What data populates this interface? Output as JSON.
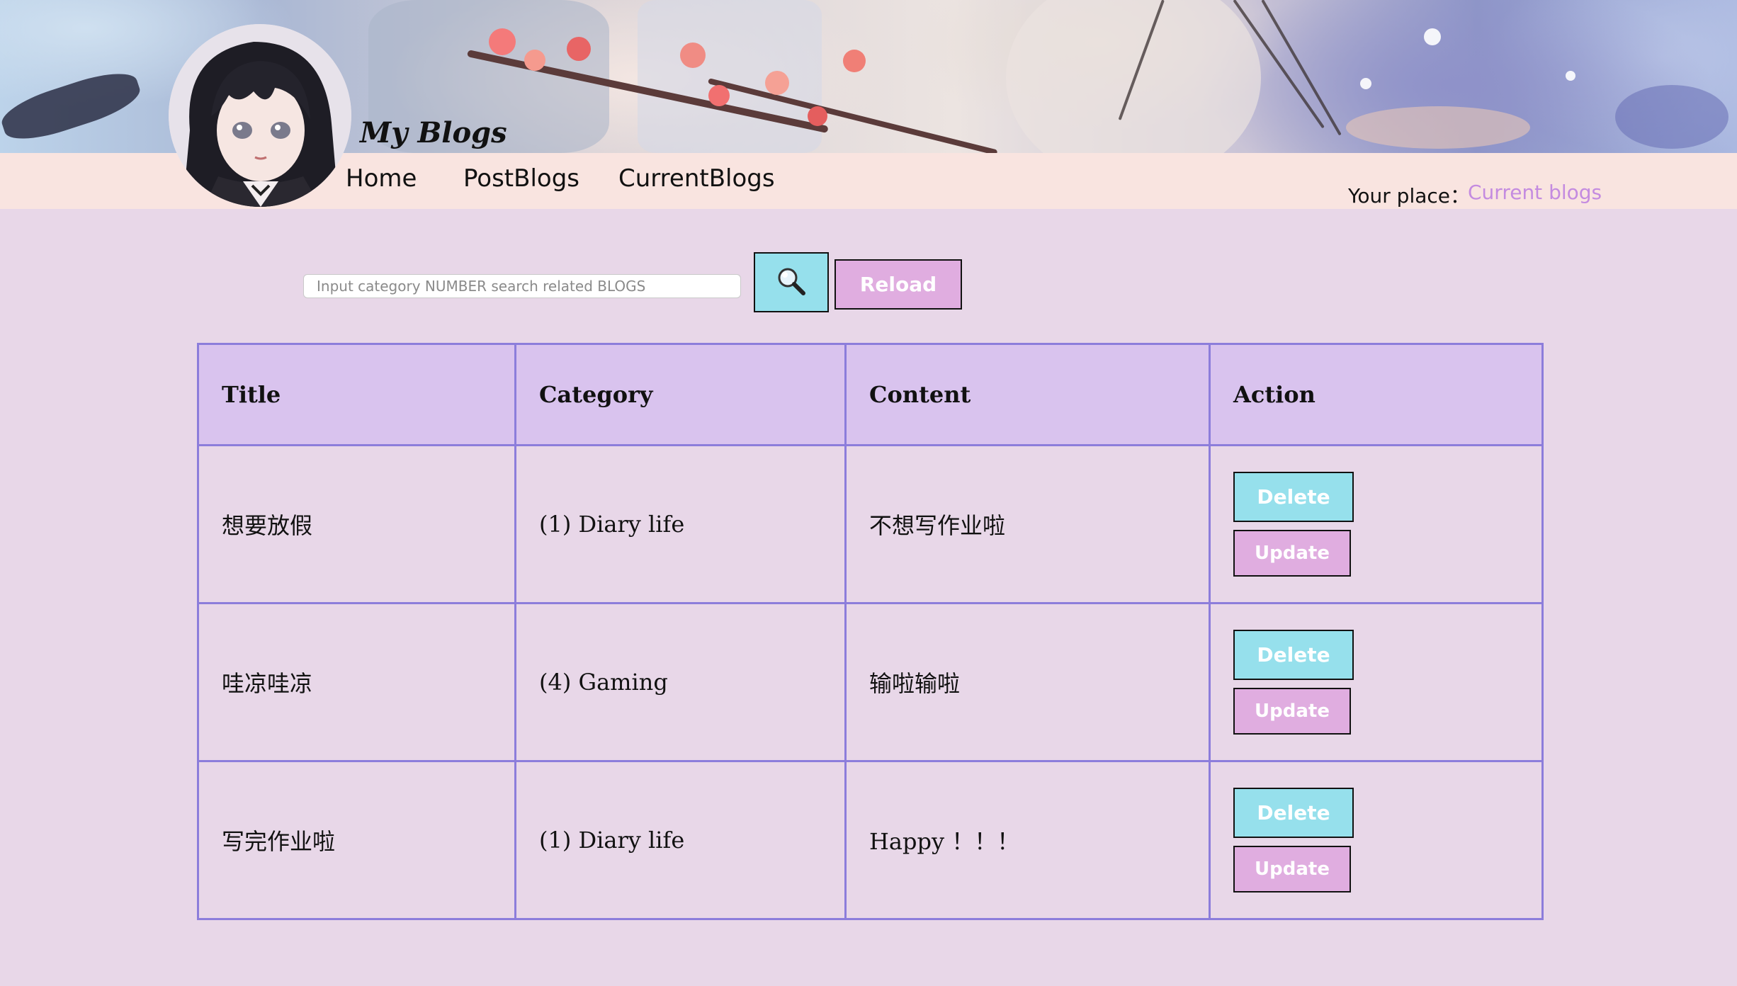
{
  "header": {
    "site_title": "My Blogs",
    "nav": [
      {
        "label": "Home"
      },
      {
        "label": "PostBlogs"
      },
      {
        "label": "CurrentBlogs"
      }
    ],
    "place_label": "Your place：",
    "place_value": "Current blogs"
  },
  "search": {
    "placeholder": "Input category NUMBER search related BLOGS",
    "value": "",
    "search_icon": "magnifier-icon",
    "reload_label": "Reload"
  },
  "table": {
    "headers": [
      "Title",
      "Category",
      "Content",
      "Action"
    ],
    "rows": [
      {
        "title": "想要放假",
        "category": "(1) Diary life",
        "content": "不想写作业啦",
        "delete_label": "Delete",
        "update_label": "Update"
      },
      {
        "title": "哇凉哇凉",
        "category": "(4) Gaming",
        "content": "输啦输啦",
        "delete_label": "Delete",
        "update_label": "Update"
      },
      {
        "title": "写完作业啦",
        "category": "(1) Diary life",
        "content": "Happy ！！！",
        "delete_label": "Delete",
        "update_label": "Update"
      }
    ]
  },
  "colors": {
    "page_bg": "#e8d7e8",
    "navbar_bg": "#f9e4e0",
    "accent_cyan": "#96e0ec",
    "accent_pink": "#e0ade0",
    "table_border": "#8c7ddb",
    "table_header_bg": "#d9c3ee",
    "place_value": "#c48be0"
  }
}
